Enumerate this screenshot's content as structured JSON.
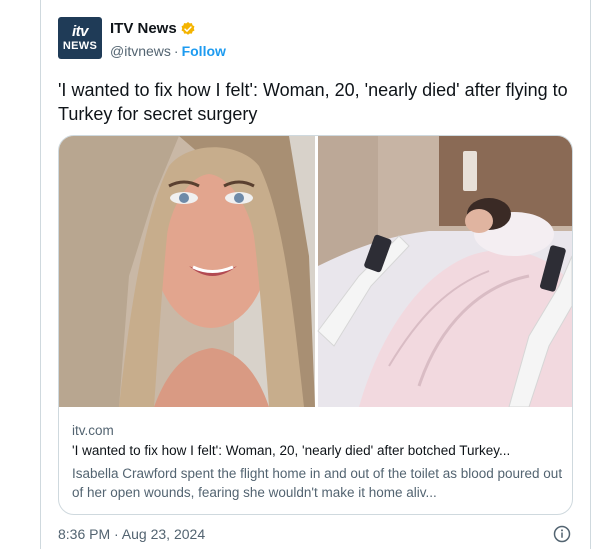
{
  "author": {
    "logo_top": "itv",
    "logo_bottom": "NEWS",
    "name": "ITV News",
    "handle": "@itvnews",
    "separator": "·",
    "follow_label": "Follow",
    "verified_color": "#f4b400"
  },
  "tweet": {
    "text": "'I wanted to fix how I felt': Woman, 20, 'nearly died' after flying to Turkey for secret surgery"
  },
  "card": {
    "domain": "itv.com",
    "title": "'I wanted to fix how I felt': Woman, 20, 'nearly died' after botched Turkey...",
    "description": "Isabella Crawford spent the flight home in and out of the toilet as blood poured out of her open wounds, fearing she wouldn't make it home aliv..."
  },
  "timestamp": "8:36 PM · Aug 23, 2024",
  "colors": {
    "link": "#1d9bf0",
    "secondary_text": "#536471",
    "border": "#cfd9de"
  }
}
